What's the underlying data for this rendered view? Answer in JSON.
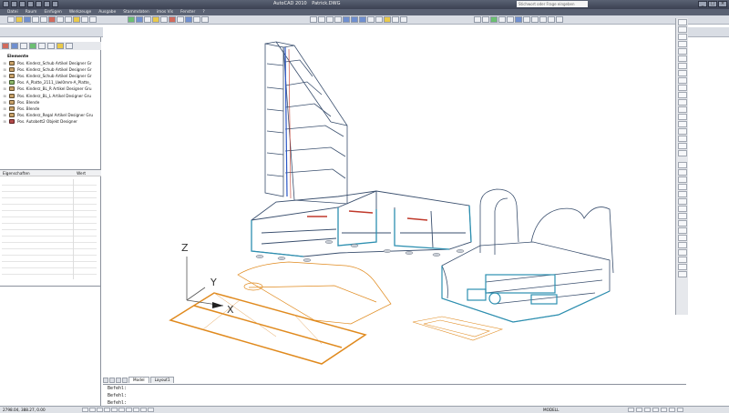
{
  "app": {
    "title": "AutoCAD 2010",
    "document": "Patrick.DWG",
    "search_placeholder": "Stichwort oder Frage eingeben"
  },
  "window_controls": {
    "minimize": "_",
    "maximize": "□",
    "close": "×"
  },
  "menu": [
    {
      "label": "Datei"
    },
    {
      "label": "Raum"
    },
    {
      "label": "Einfügen"
    },
    {
      "label": "Werkzeuge"
    },
    {
      "label": "Ausgabe"
    },
    {
      "label": "Stammdaten"
    },
    {
      "label": "imos Vis"
    },
    {
      "label": "Fenster"
    },
    {
      "label": "?"
    }
  ],
  "layer_combo": {
    "value": "0"
  },
  "element_tree": {
    "root_label": "Elemente",
    "items": [
      {
        "label": "Pos. Kinderz_Schub Artikel Designer Gr",
        "icon": "article-icon"
      },
      {
        "label": "Pos. Kinderz_Schub Artikel Designer Gr",
        "icon": "article-icon"
      },
      {
        "label": "Pos. Kinderz_Schub Artikel Designer Gr",
        "icon": "article-icon"
      },
      {
        "label": "Pos. A_Platte_2111_Uwl0mm-A_Platte_",
        "icon": "article-icon"
      },
      {
        "label": "Pos. Kinderz_BL_R Artikel Designer Gru",
        "icon": "article-icon"
      },
      {
        "label": "Pos. Kinderz_BL_L Artikel Designer Gru",
        "icon": "article-icon"
      },
      {
        "label": "Pos. Blende",
        "icon": "panel-icon"
      },
      {
        "label": "Pos. Blende",
        "icon": "panel-icon"
      },
      {
        "label": "Pos. Kinderz_Regal Artikel Designer Gru",
        "icon": "article-icon"
      },
      {
        "label": "Pos. Autobett2 Objekt Designer",
        "icon": "object-icon"
      }
    ]
  },
  "properties": {
    "col_name": "Eigenschaften",
    "col_value": "Wert"
  },
  "viewport": {
    "axis_labels": {
      "z": "Z",
      "y": "Y",
      "x": "X"
    },
    "colors": {
      "furniture": "#3a4f6e",
      "highlight": "#2c8fb0",
      "accent_red": "#c0392b",
      "orange": "#e08a1e",
      "blue_line": "#2a56c6"
    }
  },
  "layout_tabs": [
    {
      "label": "Model",
      "active": true
    },
    {
      "label": "Layout1",
      "active": false
    }
  ],
  "command_lines": [
    "Befehl:",
    "Befehl:",
    "Befehl:"
  ],
  "status": {
    "coords": "2798.04, 388.27, 0.00",
    "mode": "MODELL"
  }
}
